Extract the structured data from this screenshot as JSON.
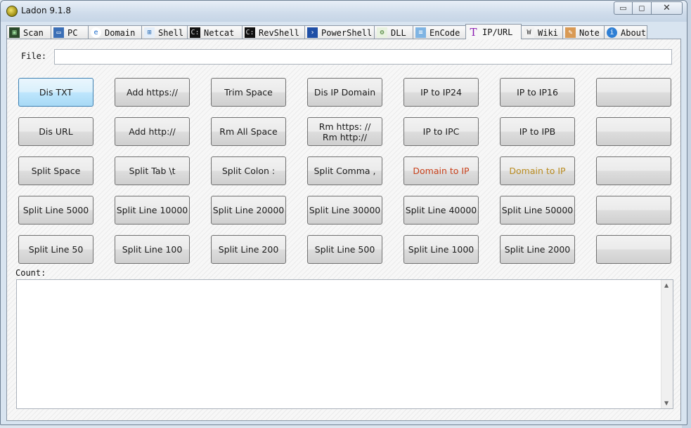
{
  "window": {
    "title": "Ladon 9.1.8",
    "controls": {
      "minimize": "▭",
      "maximize": "◻",
      "close": "✕"
    }
  },
  "tabs": [
    {
      "label": "Scan",
      "icon": "terminal-icon",
      "active": false
    },
    {
      "label": "PC",
      "icon": "monitor-icon",
      "active": false
    },
    {
      "label": "Domain",
      "icon": "ie-icon",
      "active": false
    },
    {
      "label": "Shell",
      "icon": "network-icon",
      "active": false
    },
    {
      "label": "Netcat",
      "icon": "cmd-icon",
      "active": false
    },
    {
      "label": "RevShell",
      "icon": "cmd-icon",
      "active": false
    },
    {
      "label": "PowerShell",
      "icon": "powershell-icon",
      "active": false
    },
    {
      "label": "DLL",
      "icon": "dll-icon",
      "active": false
    },
    {
      "label": "EnCode",
      "icon": "encode-icon",
      "active": false
    },
    {
      "label": "IP/URL",
      "icon": "text-t-icon",
      "active": true
    },
    {
      "label": "Wiki",
      "icon": "wiki-icon",
      "active": false
    },
    {
      "label": "Note",
      "icon": "note-icon",
      "active": false
    },
    {
      "label": "About",
      "icon": "info-icon",
      "active": false
    }
  ],
  "file": {
    "label": "File:",
    "value": ""
  },
  "buttons": [
    [
      "Dis TXT",
      "Add https://",
      "Trim Space",
      "Dis IP Domain",
      "IP to IP24",
      "IP to IP16",
      ""
    ],
    [
      "Dis URL",
      "Add http://",
      "Rm All Space",
      "Rm https: //\nRm http://",
      "IP to IPC",
      "IP to IPB",
      ""
    ],
    [
      "Split Space",
      "Split  Tab \\t",
      "Split  Colon :",
      "Split  Comma ,",
      "Domain to IP",
      "Domain to IP",
      ""
    ],
    [
      "Split Line 5000",
      "Split Line 10000",
      "Split Line 20000",
      "Split Line 30000",
      "Split Line 40000",
      "Split Line 50000",
      ""
    ],
    [
      "Split Line 50",
      "Split Line 100",
      "Split Line 200",
      "Split Line 500",
      "Split Line 1000",
      "Split Line 2000",
      ""
    ]
  ],
  "count": {
    "label": "Count:",
    "value": ""
  },
  "colors": {
    "domain_to_ip_red": "#c8401a",
    "domain_to_ip_gold": "#b88a1e",
    "selected_button": "#bee6fd"
  }
}
